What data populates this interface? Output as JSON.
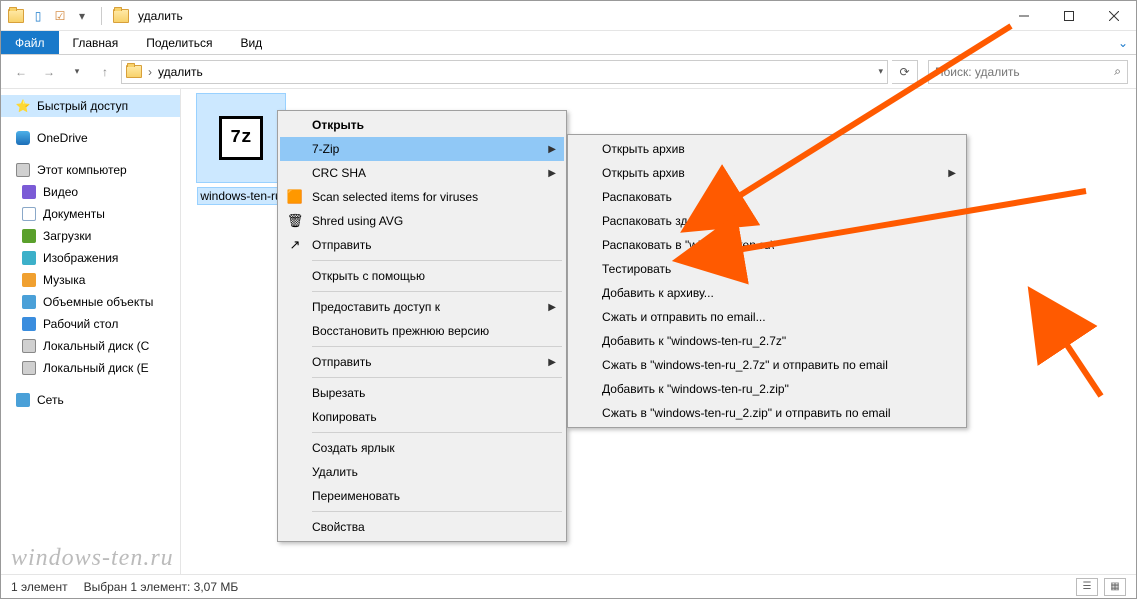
{
  "titlebar": {
    "title": "удалить"
  },
  "ribbon": {
    "file": "Файл",
    "home": "Главная",
    "share": "Поделиться",
    "view": "Вид"
  },
  "address": {
    "path": "удалить"
  },
  "search": {
    "placeholder": "Поиск: удалить"
  },
  "sidebar": {
    "quick_access": "Быстрый доступ",
    "onedrive": "OneDrive",
    "this_pc": "Этот компьютер",
    "videos": "Видео",
    "documents": "Документы",
    "downloads": "Загрузки",
    "pictures": "Изображения",
    "music": "Музыка",
    "objects_3d": "Объемные объекты",
    "desktop": "Рабочий стол",
    "local_disk_c": "Локальный диск (C",
    "local_disk_e": "Локальный диск (E",
    "network": "Сеть"
  },
  "file": {
    "name": "windows-ten-ru"
  },
  "context_menu": {
    "open": "Открыть",
    "sevenzip": "7-Zip",
    "crc_sha": "CRC SHA",
    "scan_viruses": "Scan selected items for viruses",
    "shred_avg": "Shred using AVG",
    "send_to_1": "Отправить",
    "open_with": "Открыть с помощью",
    "grant_access": "Предоставить доступ к",
    "restore_prev": "Восстановить прежнюю версию",
    "send_to_2": "Отправить",
    "cut": "Вырезать",
    "copy": "Копировать",
    "create_shortcut": "Создать ярлык",
    "delete": "Удалить",
    "rename": "Переименовать",
    "properties": "Свойства"
  },
  "submenu": {
    "open_archive_1": "Открыть архив",
    "open_archive_2": "Открыть архив",
    "extract": "Распаковать",
    "extract_here": "Распаковать здесь",
    "extract_to": "Распаковать в \"windows-ten-ru\\\"",
    "test": "Тестировать",
    "add_to_archive": "Добавить к архиву...",
    "compress_email": "Сжать и отправить по email...",
    "add_to_7z": "Добавить к \"windows-ten-ru_2.7z\"",
    "compress_7z_email": "Сжать в \"windows-ten-ru_2.7z\" и отправить по email",
    "add_to_zip": "Добавить к \"windows-ten-ru_2.zip\"",
    "compress_zip_email": "Сжать в \"windows-ten-ru_2.zip\" и отправить по email"
  },
  "statusbar": {
    "count": "1 элемент",
    "selection": "Выбран 1 элемент: 3,07 МБ"
  },
  "watermark": "windows-ten.ru"
}
